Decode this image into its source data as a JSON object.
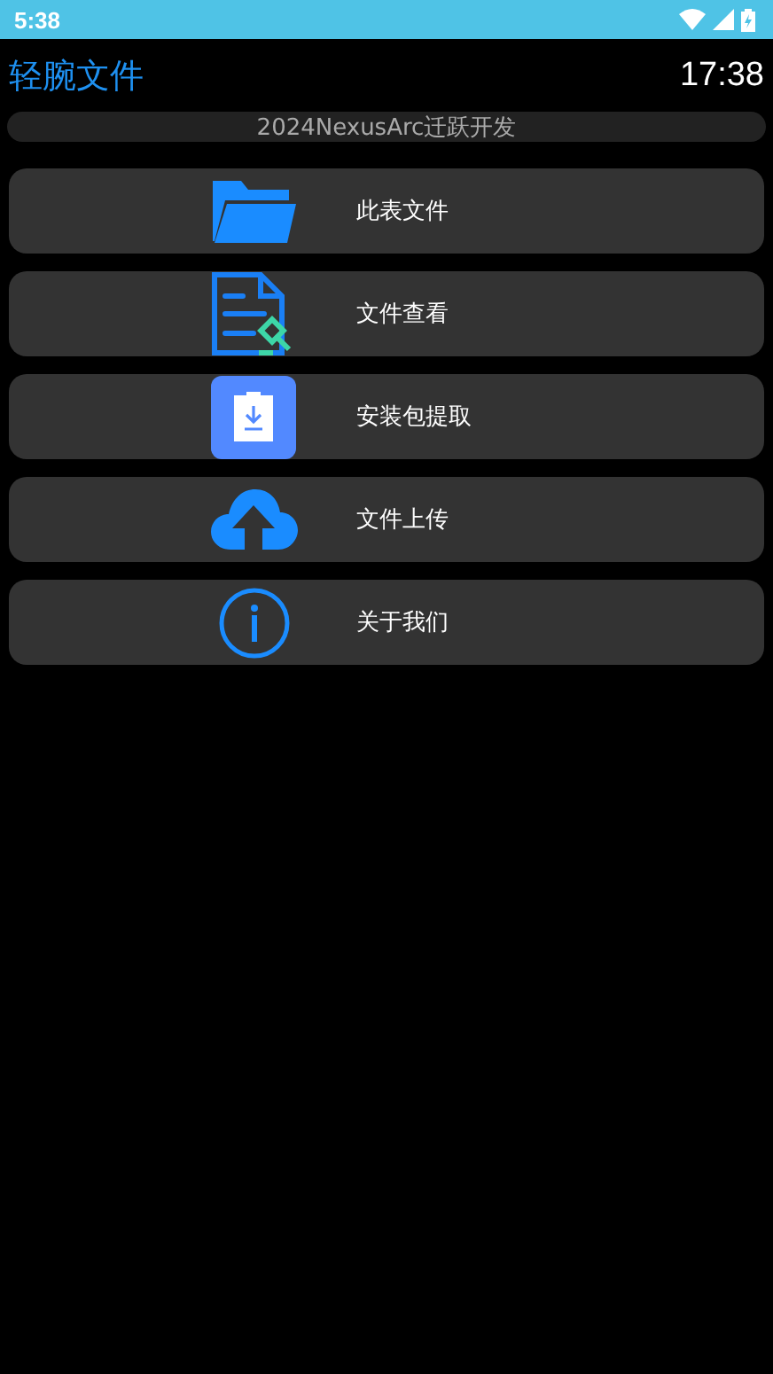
{
  "status_bar": {
    "time": "5:38"
  },
  "header": {
    "title": "轻腕文件",
    "clock": "17:38"
  },
  "banner": "2024NexusArc迁跃开发",
  "menu": [
    {
      "kind": "folder",
      "label": "此表文件"
    },
    {
      "kind": "document",
      "label": "文件查看"
    },
    {
      "kind": "package",
      "label": "安装包提取"
    },
    {
      "kind": "upload",
      "label": "文件上传"
    },
    {
      "kind": "info",
      "label": "关于我们"
    }
  ]
}
